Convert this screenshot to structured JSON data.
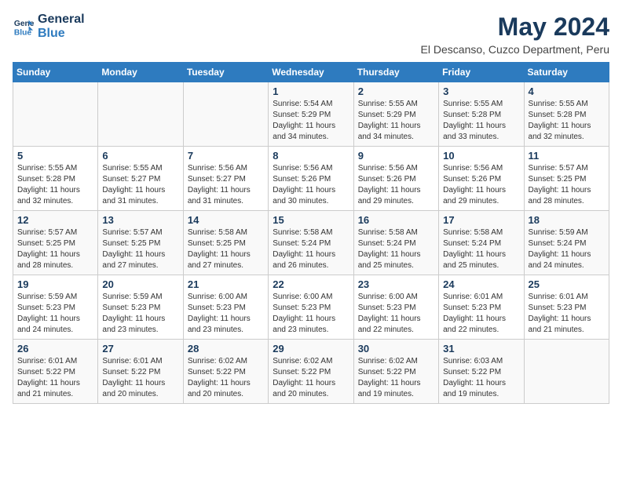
{
  "header": {
    "logo_general": "General",
    "logo_blue": "Blue",
    "month_year": "May 2024",
    "location": "El Descanso, Cuzco Department, Peru"
  },
  "days_of_week": [
    "Sunday",
    "Monday",
    "Tuesday",
    "Wednesday",
    "Thursday",
    "Friday",
    "Saturday"
  ],
  "weeks": [
    [
      {
        "day": "",
        "sunrise": "",
        "sunset": "",
        "daylight": ""
      },
      {
        "day": "",
        "sunrise": "",
        "sunset": "",
        "daylight": ""
      },
      {
        "day": "",
        "sunrise": "",
        "sunset": "",
        "daylight": ""
      },
      {
        "day": "1",
        "sunrise": "Sunrise: 5:54 AM",
        "sunset": "Sunset: 5:29 PM",
        "daylight": "Daylight: 11 hours and 34 minutes."
      },
      {
        "day": "2",
        "sunrise": "Sunrise: 5:55 AM",
        "sunset": "Sunset: 5:29 PM",
        "daylight": "Daylight: 11 hours and 34 minutes."
      },
      {
        "day": "3",
        "sunrise": "Sunrise: 5:55 AM",
        "sunset": "Sunset: 5:28 PM",
        "daylight": "Daylight: 11 hours and 33 minutes."
      },
      {
        "day": "4",
        "sunrise": "Sunrise: 5:55 AM",
        "sunset": "Sunset: 5:28 PM",
        "daylight": "Daylight: 11 hours and 32 minutes."
      }
    ],
    [
      {
        "day": "5",
        "sunrise": "Sunrise: 5:55 AM",
        "sunset": "Sunset: 5:28 PM",
        "daylight": "Daylight: 11 hours and 32 minutes."
      },
      {
        "day": "6",
        "sunrise": "Sunrise: 5:55 AM",
        "sunset": "Sunset: 5:27 PM",
        "daylight": "Daylight: 11 hours and 31 minutes."
      },
      {
        "day": "7",
        "sunrise": "Sunrise: 5:56 AM",
        "sunset": "Sunset: 5:27 PM",
        "daylight": "Daylight: 11 hours and 31 minutes."
      },
      {
        "day": "8",
        "sunrise": "Sunrise: 5:56 AM",
        "sunset": "Sunset: 5:26 PM",
        "daylight": "Daylight: 11 hours and 30 minutes."
      },
      {
        "day": "9",
        "sunrise": "Sunrise: 5:56 AM",
        "sunset": "Sunset: 5:26 PM",
        "daylight": "Daylight: 11 hours and 29 minutes."
      },
      {
        "day": "10",
        "sunrise": "Sunrise: 5:56 AM",
        "sunset": "Sunset: 5:26 PM",
        "daylight": "Daylight: 11 hours and 29 minutes."
      },
      {
        "day": "11",
        "sunrise": "Sunrise: 5:57 AM",
        "sunset": "Sunset: 5:25 PM",
        "daylight": "Daylight: 11 hours and 28 minutes."
      }
    ],
    [
      {
        "day": "12",
        "sunrise": "Sunrise: 5:57 AM",
        "sunset": "Sunset: 5:25 PM",
        "daylight": "Daylight: 11 hours and 28 minutes."
      },
      {
        "day": "13",
        "sunrise": "Sunrise: 5:57 AM",
        "sunset": "Sunset: 5:25 PM",
        "daylight": "Daylight: 11 hours and 27 minutes."
      },
      {
        "day": "14",
        "sunrise": "Sunrise: 5:58 AM",
        "sunset": "Sunset: 5:25 PM",
        "daylight": "Daylight: 11 hours and 27 minutes."
      },
      {
        "day": "15",
        "sunrise": "Sunrise: 5:58 AM",
        "sunset": "Sunset: 5:24 PM",
        "daylight": "Daylight: 11 hours and 26 minutes."
      },
      {
        "day": "16",
        "sunrise": "Sunrise: 5:58 AM",
        "sunset": "Sunset: 5:24 PM",
        "daylight": "Daylight: 11 hours and 25 minutes."
      },
      {
        "day": "17",
        "sunrise": "Sunrise: 5:58 AM",
        "sunset": "Sunset: 5:24 PM",
        "daylight": "Daylight: 11 hours and 25 minutes."
      },
      {
        "day": "18",
        "sunrise": "Sunrise: 5:59 AM",
        "sunset": "Sunset: 5:24 PM",
        "daylight": "Daylight: 11 hours and 24 minutes."
      }
    ],
    [
      {
        "day": "19",
        "sunrise": "Sunrise: 5:59 AM",
        "sunset": "Sunset: 5:23 PM",
        "daylight": "Daylight: 11 hours and 24 minutes."
      },
      {
        "day": "20",
        "sunrise": "Sunrise: 5:59 AM",
        "sunset": "Sunset: 5:23 PM",
        "daylight": "Daylight: 11 hours and 23 minutes."
      },
      {
        "day": "21",
        "sunrise": "Sunrise: 6:00 AM",
        "sunset": "Sunset: 5:23 PM",
        "daylight": "Daylight: 11 hours and 23 minutes."
      },
      {
        "day": "22",
        "sunrise": "Sunrise: 6:00 AM",
        "sunset": "Sunset: 5:23 PM",
        "daylight": "Daylight: 11 hours and 23 minutes."
      },
      {
        "day": "23",
        "sunrise": "Sunrise: 6:00 AM",
        "sunset": "Sunset: 5:23 PM",
        "daylight": "Daylight: 11 hours and 22 minutes."
      },
      {
        "day": "24",
        "sunrise": "Sunrise: 6:01 AM",
        "sunset": "Sunset: 5:23 PM",
        "daylight": "Daylight: 11 hours and 22 minutes."
      },
      {
        "day": "25",
        "sunrise": "Sunrise: 6:01 AM",
        "sunset": "Sunset: 5:23 PM",
        "daylight": "Daylight: 11 hours and 21 minutes."
      }
    ],
    [
      {
        "day": "26",
        "sunrise": "Sunrise: 6:01 AM",
        "sunset": "Sunset: 5:22 PM",
        "daylight": "Daylight: 11 hours and 21 minutes."
      },
      {
        "day": "27",
        "sunrise": "Sunrise: 6:01 AM",
        "sunset": "Sunset: 5:22 PM",
        "daylight": "Daylight: 11 hours and 20 minutes."
      },
      {
        "day": "28",
        "sunrise": "Sunrise: 6:02 AM",
        "sunset": "Sunset: 5:22 PM",
        "daylight": "Daylight: 11 hours and 20 minutes."
      },
      {
        "day": "29",
        "sunrise": "Sunrise: 6:02 AM",
        "sunset": "Sunset: 5:22 PM",
        "daylight": "Daylight: 11 hours and 20 minutes."
      },
      {
        "day": "30",
        "sunrise": "Sunrise: 6:02 AM",
        "sunset": "Sunset: 5:22 PM",
        "daylight": "Daylight: 11 hours and 19 minutes."
      },
      {
        "day": "31",
        "sunrise": "Sunrise: 6:03 AM",
        "sunset": "Sunset: 5:22 PM",
        "daylight": "Daylight: 11 hours and 19 minutes."
      },
      {
        "day": "",
        "sunrise": "",
        "sunset": "",
        "daylight": ""
      }
    ]
  ]
}
